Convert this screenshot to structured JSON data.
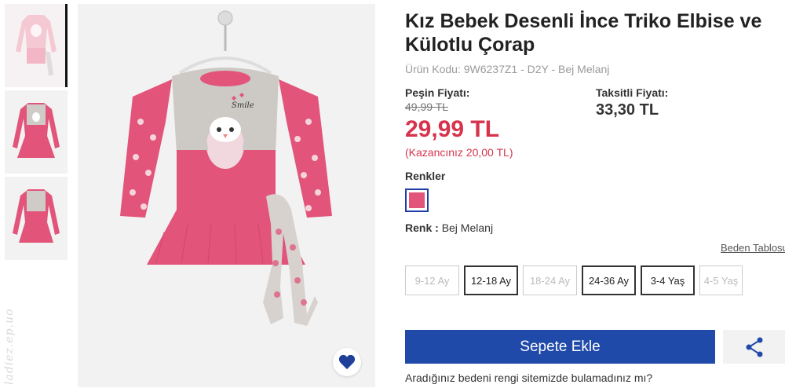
{
  "product": {
    "title_line1": "Kız Bebek Desenli İnce Triko Elbise ve",
    "title_line2": "Külotlu Çorap",
    "code_text": "Ürün Kodu: 9W6237Z1 - D2Y - Bej Melanj"
  },
  "price": {
    "cash_label": "Peşin Fiyatı:",
    "old": "49,99 TL",
    "current": "29,99 TL",
    "saving": "(Kazancınız 20,00 TL)",
    "installment_label": "Taksitli Fiyatı:",
    "installment": "33,30 TL"
  },
  "colors": {
    "label": "Renkler",
    "selected_swatch": "#e2547a",
    "color_label": "Renk :",
    "color_value": "Bej Melanj"
  },
  "sizes": {
    "size_table_link": "Beden Tablosu",
    "options": [
      {
        "label": "9-12 Ay",
        "available": false
      },
      {
        "label": "12-18 Ay",
        "available": true
      },
      {
        "label": "18-24 Ay",
        "available": false
      },
      {
        "label": "24-36 Ay",
        "available": true
      },
      {
        "label": "3-4 Yaş",
        "available": true
      },
      {
        "label": "4-5 Yaş",
        "available": false
      }
    ]
  },
  "actions": {
    "add_to_cart": "Sepete Ekle",
    "not_found_text": "Aradığınız bedeni rengi sitemizde bulamadınız mı?"
  },
  "icons": {
    "favorite": "heart-icon",
    "share": "share-icon"
  },
  "watermark": "ladiez.ep.uo",
  "theme": {
    "accent_blue": "#1f4aa9",
    "price_red": "#d6344d",
    "dress_pink": "#e2547a"
  }
}
